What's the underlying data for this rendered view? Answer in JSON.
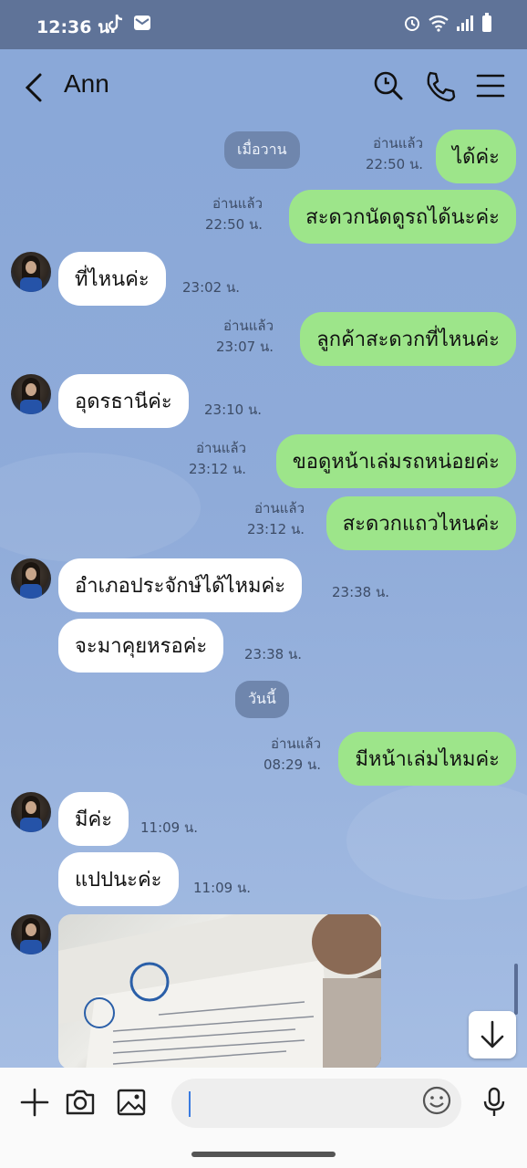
{
  "status_bar": {
    "time": "12:36 น.",
    "left_icons": [
      "tiktok-icon",
      "mail-icon"
    ],
    "right_icons": [
      "alarm-icon",
      "wifi-icon",
      "signal-icon",
      "battery-icon"
    ]
  },
  "header": {
    "contact_name": "Ann",
    "icons": [
      "search-icon",
      "phone-icon",
      "menu-icon"
    ]
  },
  "chat": {
    "date_yesterday": "เมื่อวาน",
    "date_today": "วันนี้",
    "read_label": "อ่านแล้ว",
    "messages": [
      {
        "dir": "out",
        "text": "ได้ค่ะ",
        "time": "22:50 น.",
        "read": "อ่านแล้ว"
      },
      {
        "dir": "out",
        "text": "สะดวกนัดดูรถได้นะค่ะ",
        "time": "22:50 น.",
        "read": "อ่านแล้ว"
      },
      {
        "dir": "in",
        "text": "ที่ไหนค่ะ",
        "time": "23:02 น."
      },
      {
        "dir": "out",
        "text": "ลูกค้าสะดวกที่ไหนค่ะ",
        "time": "23:07 น.",
        "read": "อ่านแล้ว"
      },
      {
        "dir": "in",
        "text": "อุดรธานีค่ะ",
        "time": "23:10 น."
      },
      {
        "dir": "out",
        "text": "ขอดูหน้าเล่มรถหน่อยค่ะ",
        "time": "23:12 น.",
        "read": "อ่านแล้ว"
      },
      {
        "dir": "out",
        "text": "สะดวกแถวไหนค่ะ",
        "time": "23:12 น.",
        "read": "อ่านแล้ว"
      },
      {
        "dir": "in",
        "text": "อำเภอประจักษ์ได้ไหมค่ะ",
        "time": "23:38 น."
      },
      {
        "dir": "in",
        "text": "จะมาคุยหรอค่ะ",
        "time": "23:38 น."
      },
      {
        "dir": "out",
        "text": "มีหน้าเล่มไหมค่ะ",
        "time": "08:29 น.",
        "read": "อ่านแล้ว"
      },
      {
        "dir": "in",
        "text": "มีค่ะ",
        "time": "11:09 น."
      },
      {
        "dir": "in",
        "text": "แปปนะค่ะ",
        "time": "11:09 น."
      }
    ]
  },
  "composer": {
    "placeholder": "",
    "icons": [
      "plus-icon",
      "camera-icon",
      "image-icon",
      "emoji-icon",
      "microphone-icon"
    ]
  },
  "colors": {
    "background": "#8aa8d8",
    "outgoing_bubble": "#9de58a",
    "incoming_bubble": "#ffffff",
    "status_bar": "#5f7398"
  }
}
